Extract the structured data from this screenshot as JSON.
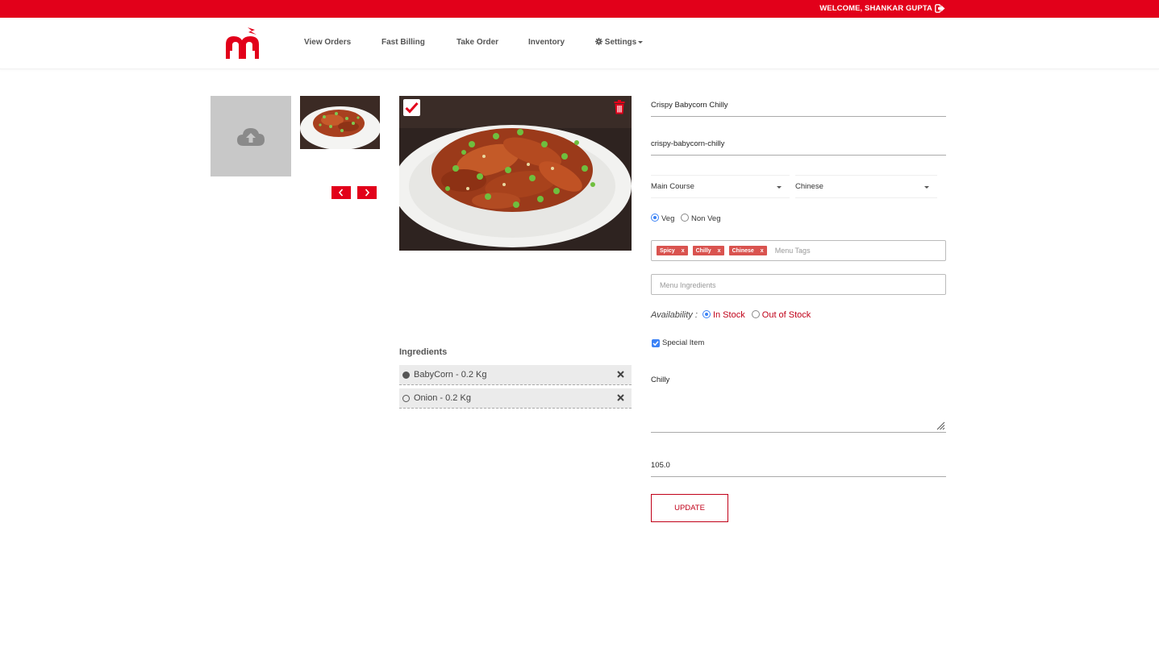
{
  "topbar": {
    "welcome_text": "WELCOME, SHANKAR GUPTA",
    "icon": "logout-icon",
    "color": "#e2001a"
  },
  "nav": {
    "logo_icon": "brand-logo",
    "items": [
      "View Orders",
      "Fast Billing",
      "Take Order",
      "Inventory"
    ],
    "settings_label": "Settings",
    "settings_icon": "gear-icon"
  },
  "gallery": {
    "upload_icon": "cloud-upload-icon",
    "thumbnail_alt": "Crispy Babycorn Chilly",
    "prev_icon": "chevron-left-icon",
    "next_icon": "chevron-right-icon"
  },
  "main_image": {
    "alt": "Crispy Babycorn Chilly",
    "selected_icon": "check-icon",
    "delete_icon": "trash-icon"
  },
  "ingredients": {
    "title": "Ingredients",
    "items": [
      {
        "label": "BabyCorn - 0.2 Kg",
        "filled": true
      },
      {
        "label": "Onion - 0.2 Kg",
        "filled": false
      }
    ]
  },
  "form": {
    "name": "Crispy Babycorn Chilly",
    "slug": "crispy-babycorn-chilly",
    "category": "Main Course",
    "cuisine": "Chinese",
    "veg_label": "Veg",
    "nonveg_label": "Non Veg",
    "veg_selected": "Veg",
    "tags": [
      "Spicy",
      "Chilly",
      "Chinese"
    ],
    "tag_remove": "x",
    "tags_placeholder": "Menu Tags",
    "ingredients_placeholder": "Menu Ingredients",
    "availability_label": "Availability :",
    "in_stock_label": "In Stock",
    "out_stock_label": "Out of Stock",
    "availability_selected": "In Stock",
    "special_label": "Special Item",
    "special_checked": true,
    "description": "Chilly",
    "price": "105.0",
    "update_label": "UPDATE"
  }
}
